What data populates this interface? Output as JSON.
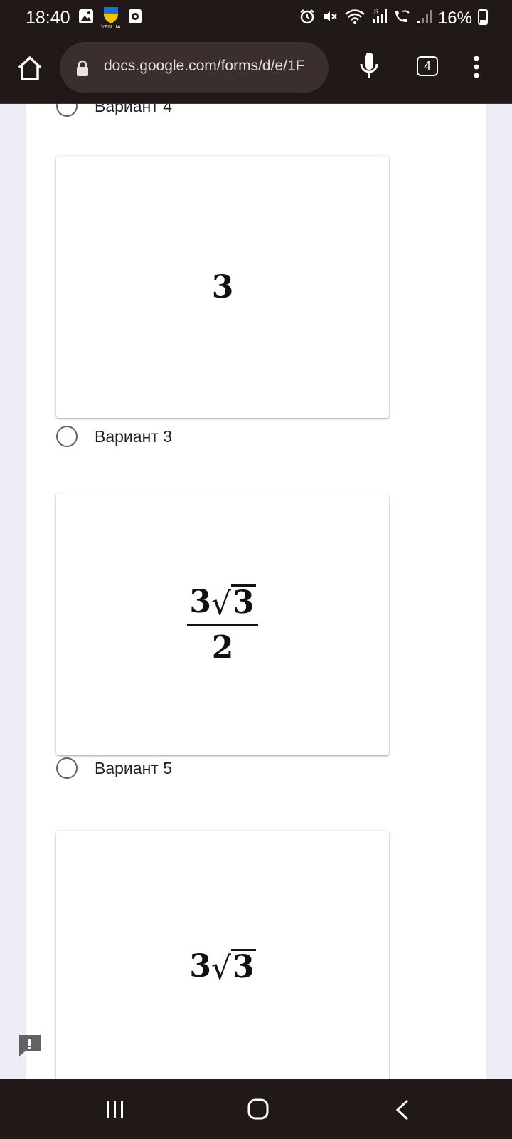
{
  "status_bar": {
    "time": "18:40",
    "vpn_label": "VPN UA",
    "battery": "16%",
    "icons": [
      "image-icon",
      "vpn-shield-icon",
      "screen-record-icon",
      "alarm-icon",
      "mute-icon",
      "wifi-icon",
      "signal-roaming-icon",
      "wifi-call-icon",
      "signal-icon",
      "battery-icon"
    ]
  },
  "browser": {
    "url": "docs.google.com/forms/d/e/1F",
    "tab_count": "4"
  },
  "form": {
    "options": [
      {
        "label": "Вариант 4",
        "formula": null
      },
      {
        "label": "Вариант 3",
        "formula": "3"
      },
      {
        "label": "Вариант 5",
        "formula": "3√3 / 2"
      },
      {
        "label": null,
        "formula": "3√3"
      }
    ],
    "image1": {
      "value": "3"
    },
    "image2": {
      "numerator_coef": "3",
      "numerator_radicand": "3",
      "denominator": "2"
    },
    "image3": {
      "coef": "3",
      "radicand": "3"
    }
  },
  "colors": {
    "chrome": "#201918",
    "page_bg": "#efebf7",
    "card_bg": "#ffffff",
    "radio": "#5f6368"
  }
}
